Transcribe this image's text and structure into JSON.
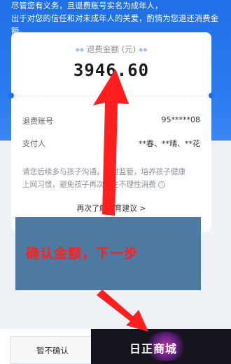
{
  "header": {
    "line1": "尽管您有义务，且退费账号实名为成年人，",
    "line2": "出于对您的信任和对未成年人的关爱，酌情为您退还消费金额。"
  },
  "card": {
    "amount_label": "退费金额 (元)",
    "amount": "3946.60",
    "rows": [
      {
        "label": "退费账号",
        "value": "95*****08"
      },
      {
        "label": "支付人",
        "value": "**春、**晴、**花"
      }
    ],
    "tip_line1": "请您后续多与孩子沟通，适时监管，培养孩子健康",
    "tip_line2": "上网习惯，避免孩子再次产生不理性消费",
    "edu_link": "再次了解教育建议 >"
  },
  "overlay": {
    "message": "确认金额，下一步"
  },
  "bottom": {
    "cancel_label": "暂不确认"
  },
  "watermark": {
    "text": "日正商城"
  },
  "colors": {
    "brand_blue": "#1f6fe6",
    "overlay": "#4e79a0",
    "arrow_red": "#ff1f1f"
  }
}
